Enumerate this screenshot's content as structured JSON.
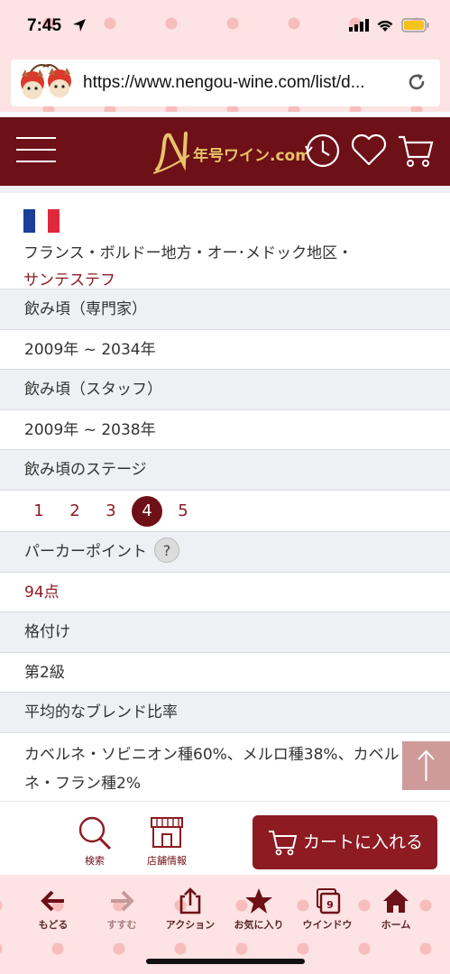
{
  "status": {
    "time": "7:45"
  },
  "browser": {
    "url": "https://www.nengou-wine.com/list/d..."
  },
  "site": {
    "logo_text": "年号ワイン.com"
  },
  "region": {
    "line1": "フランス・ボルドー地方・オー･メドック地区・",
    "link": "サンテステフ"
  },
  "rows": {
    "drinking_expert_label": "飲み頃（専門家）",
    "drinking_expert_value": "2009年 ~ 2034年",
    "drinking_staff_label": "飲み頃（スタッフ）",
    "drinking_staff_value": "2009年 ~ 2038年",
    "stage_label": "飲み頃のステージ",
    "stages": [
      "1",
      "2",
      "3",
      "4",
      "5"
    ],
    "stage_active": 4,
    "parker_label": "パーカーポイント",
    "parker_help": "?",
    "parker_value": "94点",
    "rank_label": "格付け",
    "rank_value": "第2級",
    "blend_label": "平均的なブレンド比率",
    "blend_value": "カベルネ・ソビニオン種60%、メルロ種38%、カベルネ・フラン種2%"
  },
  "sticky": {
    "search": "検索",
    "store": "店舗情報",
    "cart": "カートに入れる"
  },
  "toolbar": {
    "back": "もどる",
    "forward": "すすむ",
    "action": "アクション",
    "favorites": "お気に入り",
    "windows": "ウインドウ",
    "windows_count": "9",
    "home": "ホーム"
  },
  "colors": {
    "brand": "#6e1017",
    "accent": "#8e1b22",
    "chrome": "#fde3e3"
  }
}
